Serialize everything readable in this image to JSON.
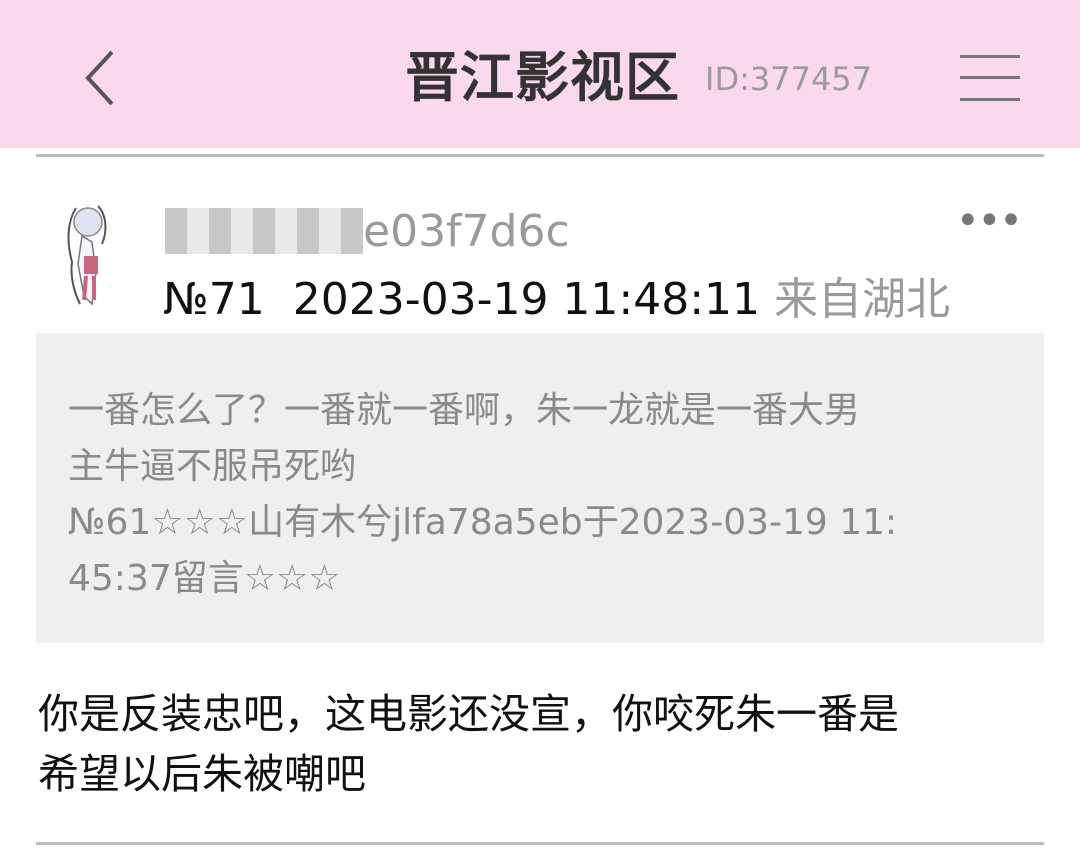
{
  "header": {
    "title": "晋江影视区",
    "board_id": "ID:377457",
    "back_icon": "chevron-left-icon",
    "menu_icon": "hamburger-menu-icon",
    "background": "#fbd9ec"
  },
  "post": {
    "username_visible": "e03f7d6c",
    "more_label": "•••",
    "floor": "№71",
    "timestamp": "2023-03-19 11:48:11",
    "location": "来自湖北",
    "quote": {
      "line1": "一番怎么了？一番就一番啊，朱一龙就是一番大男",
      "line2": "主牛逼不服吊死哟",
      "line3": "№61☆☆☆山有木兮jlfa78a5eb于2023-03-19 11:",
      "line4": "45:37留言☆☆☆"
    },
    "reply": {
      "line1": "你是反装忠吧，这电影还没宣，你咬死朱一番是",
      "line2": "希望以后朱被嘲吧"
    }
  }
}
